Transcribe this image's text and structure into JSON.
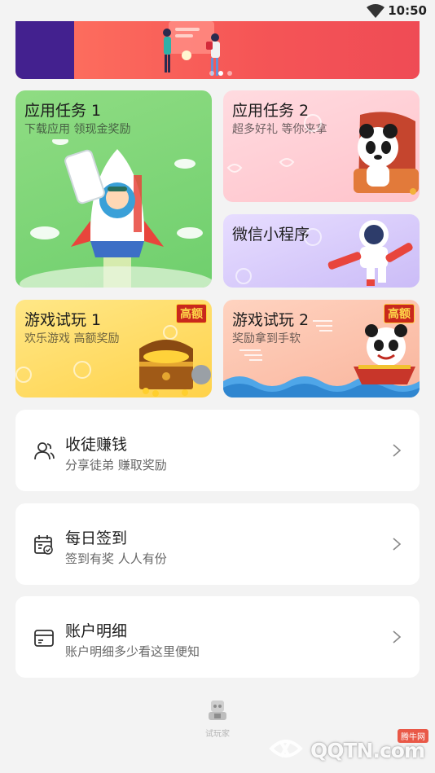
{
  "status_bar": {
    "time": "10:50"
  },
  "banner": {
    "dots": 3,
    "active_dot": 1
  },
  "tasks": {
    "app1": {
      "title": "应用任务 1",
      "subtitle": "下载应用 领现金奖励"
    },
    "app2": {
      "title": "应用任务 2",
      "subtitle": "超多好礼 等你来拿"
    },
    "wechat": {
      "title": "微信小程序"
    },
    "game1": {
      "title": "游戏试玩 1",
      "subtitle": "欢乐游戏 高额奖励",
      "badge": "高额"
    },
    "game2": {
      "title": "游戏试玩 2",
      "subtitle": "奖励拿到手软",
      "badge": "高额"
    }
  },
  "menu": {
    "apprentice": {
      "title": "收徒赚钱",
      "subtitle": "分享徒弟 赚取奖励"
    },
    "checkin": {
      "title": "每日签到",
      "subtitle": "签到有奖 人人有份"
    },
    "account": {
      "title": "账户明细",
      "subtitle": "账户明细多少看这里便知"
    }
  },
  "footer": {
    "brand_label": "试玩家"
  },
  "watermark": {
    "text": "QQTN.com",
    "badge": "腾牛网"
  }
}
